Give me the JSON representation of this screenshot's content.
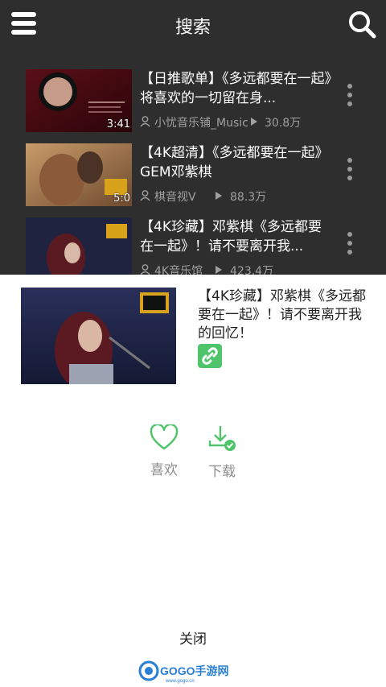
{
  "header": {
    "title": "搜索",
    "menu_icon": "menu-icon",
    "search_icon": "search-icon"
  },
  "results": [
    {
      "title": "【日推歌单】《多远都要在一起》将喜欢的一切留在身...",
      "duration": "3:41",
      "author": "小忧音乐铺_Music",
      "views": "30.8万"
    },
    {
      "title": "【4K超清】《多远都要在一起》GEM邓紫棋",
      "duration": "5:0",
      "author": "棋音视V",
      "views": "88.3万"
    },
    {
      "title": "【4K珍藏】邓紫棋《多远都要在一起》！请不要离开我...",
      "duration": "",
      "author": "4K音乐馆",
      "views": "423.4万"
    }
  ],
  "sheet": {
    "title": "【4K珍藏】邓紫棋《多远都要在一起》！请不要离开我的回忆！",
    "like_label": "喜欢",
    "download_label": "下载",
    "close_label": "关闭"
  },
  "watermark": {
    "text": "GOGO手游网",
    "sub": "www.gogo.cn"
  },
  "colors": {
    "header_bg": "#2e2e2e",
    "accent_green": "#4fc46a",
    "sheet_bg": "#ffffff"
  }
}
